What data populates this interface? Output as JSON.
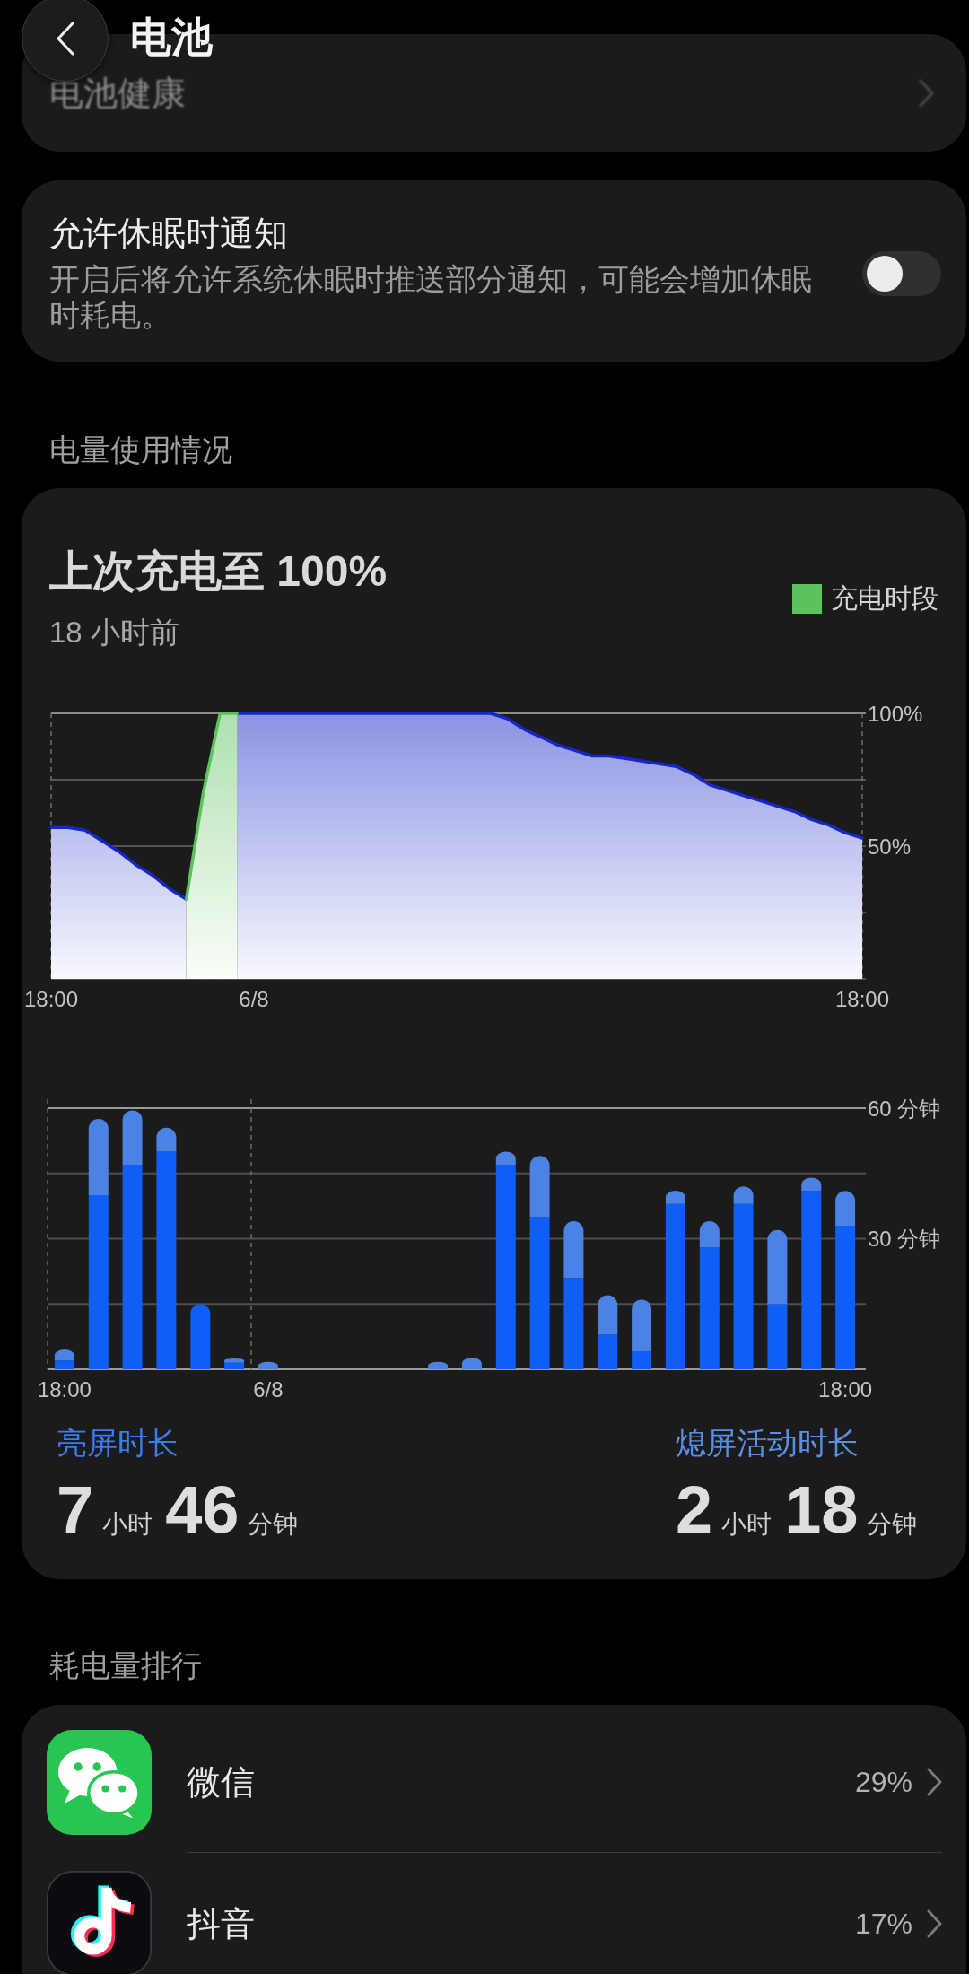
{
  "header": {
    "title": "电池"
  },
  "battery_health": {
    "label": "电池健康"
  },
  "sleep_notifications": {
    "title": "允许休眠时通知",
    "description": "开启后将允许系统休眠时推送部分通知，可能会增加休眠时耗电。",
    "on": false
  },
  "usage_heading": "电量使用情况",
  "usage_card": {
    "title": "上次充电至 100%",
    "subtitle": "18 小时前",
    "battery_chart": {
      "chart_data": {
        "type": "area",
        "categories": [
          "18:00",
          null,
          null,
          null,
          null,
          null,
          null,
          null,
          null,
          null,
          null,
          null,
          "6/8",
          null,
          null,
          null,
          null,
          null,
          null,
          null,
          null,
          null,
          null,
          null,
          null,
          null,
          null,
          null,
          null,
          null,
          null,
          null,
          null,
          null,
          null,
          null,
          null,
          null,
          null,
          null,
          null,
          null,
          null,
          null,
          null,
          null,
          null,
          null,
          "18:00"
        ],
        "series": [
          {
            "color": "#1626c8",
            "values": [
              57,
              57,
              56,
              52,
              48,
              43,
              39,
              34,
              30,
              null,
              null,
              100,
              100,
              100,
              100,
              100,
              100,
              100,
              100,
              100,
              100,
              100,
              100,
              100,
              100,
              100,
              100,
              98,
              94,
              91,
              88,
              86,
              84,
              84,
              83,
              82,
              81,
              80,
              77,
              73,
              71,
              69,
              67,
              65,
              63,
              60,
              58,
              55,
              53
            ]
          },
          {
            "name": "充电时段",
            "color": "#5cc25c",
            "values": [
              null,
              null,
              null,
              null,
              null,
              null,
              null,
              null,
              30,
              70,
              100,
              100,
              null,
              null,
              null,
              null,
              null,
              null,
              null,
              null,
              null,
              null,
              null,
              null,
              null,
              null,
              null,
              null,
              null,
              null,
              null,
              null,
              null,
              null,
              null,
              null,
              null,
              null,
              null,
              null,
              null,
              null,
              null,
              null,
              null,
              null,
              null,
              null,
              null
            ]
          }
        ],
        "ylim": [
          0,
          100
        ],
        "yticks": [
          {
            "value": 100,
            "label": "100%"
          },
          {
            "value": 50,
            "label": "50%"
          }
        ]
      }
    },
    "activity_chart": {
      "chart_data": {
        "type": "bar",
        "stacked": true,
        "categories": [
          "18:00",
          null,
          null,
          null,
          null,
          null,
          "6/8",
          null,
          null,
          null,
          null,
          null,
          null,
          null,
          null,
          null,
          null,
          null,
          null,
          null,
          null,
          null,
          null,
          "18:00"
        ],
        "series": [
          {
            "color": "#0f5ef7",
            "values": [
              2,
              40,
              47,
              50,
              15,
              1.5,
              0,
              0,
              0,
              0,
              0,
              0,
              0,
              47,
              35,
              21,
              8,
              4,
              38,
              28,
              38,
              15,
              41,
              33
            ]
          },
          {
            "color": "#4b82e3",
            "values": [
              2.5,
              17.5,
              12.5,
              5.5,
              0,
              1,
              1.7,
              0,
              0,
              0,
              0,
              1.7,
              2.7,
              3,
              14,
              13,
              9,
              12,
              3,
              6,
              4,
              17,
              3,
              8
            ]
          }
        ],
        "ylim": [
          0,
          60
        ],
        "yticks": [
          {
            "value": 60,
            "label": "60 分钟"
          },
          {
            "value": 30,
            "label": "30 分钟"
          }
        ]
      }
    },
    "stats": [
      {
        "label": "亮屏时长",
        "color": "#3b7cf2",
        "hours": "7",
        "hours_unit": "小时",
        "minutes": "46",
        "minutes_unit": "分钟"
      },
      {
        "label": "熄屏活动时长",
        "color": "#5a8fe6",
        "hours": "2",
        "hours_unit": "小时",
        "minutes": "18",
        "minutes_unit": "分钟"
      }
    ]
  },
  "ranking": {
    "heading": "耗电量排行",
    "apps": [
      {
        "kind": "chat",
        "name": "微信",
        "percent": "29%"
      },
      {
        "kind": "music",
        "name": "抖音",
        "percent": "17%"
      }
    ]
  }
}
